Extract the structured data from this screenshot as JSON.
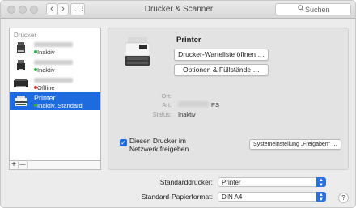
{
  "window": {
    "title": "Drucker & Scanner",
    "search_placeholder": "Suchen",
    "back_icon": "‹",
    "forward_icon": "›",
    "grid_icon": "⋮⋮⋮"
  },
  "printer_list": {
    "header": "Drucker",
    "items": [
      {
        "name": "",
        "status": "Inaktiv",
        "status_color": "#2fb24a",
        "selected": false
      },
      {
        "name": "",
        "status": "Inaktiv",
        "status_color": "#2fb24a",
        "selected": false
      },
      {
        "name": "",
        "status": "Offline",
        "status_color": "#d93a3a",
        "selected": false
      },
      {
        "name": "Printer",
        "status": "Inaktiv, Standard",
        "status_color": "#2fb24a",
        "selected": true
      }
    ],
    "add_label": "+",
    "remove_label": "—"
  },
  "detail": {
    "printer_name": "Printer",
    "open_queue_button": "Drucker-Warteliste öffnen …",
    "options_button": "Optionen & Füllstände …",
    "ort_label": "Ort:",
    "ort_value": "",
    "art_label": "Art:",
    "art_value_suffix": "PS",
    "status_label": "Status:",
    "status_value": "Inaktiv",
    "share_checkbox_checked": true,
    "share_label": "Diesen Drucker im Netzwerk freigeben",
    "sharing_prefs_button": "Systemeinstellung „Freigaben“ …"
  },
  "defaults": {
    "default_printer_label": "Standarddrucker:",
    "default_printer_value": "Printer",
    "default_paper_label": "Standard-Papierformat:",
    "default_paper_value": "DIN A4"
  },
  "help_label": "?",
  "colors": {
    "accent": "#1e6be0",
    "status_ok": "#2fb24a",
    "status_offline": "#d93a3a"
  }
}
